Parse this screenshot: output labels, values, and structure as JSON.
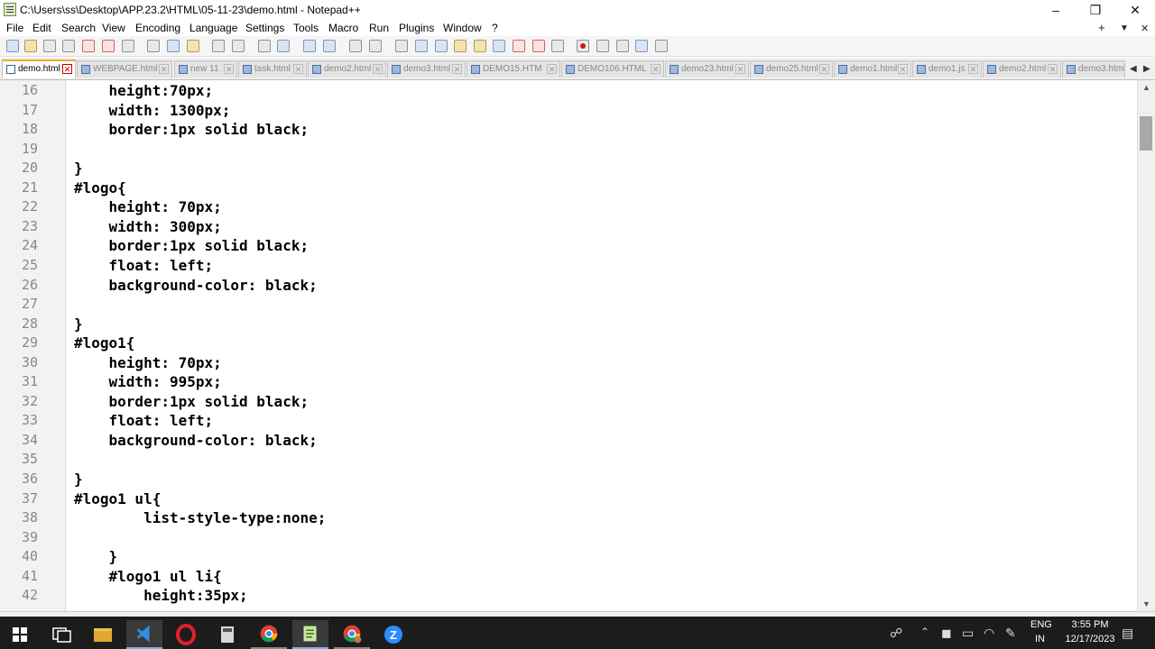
{
  "window": {
    "title": "C:\\Users\\ss\\Desktop\\APP.23.2\\HTML\\05-11-23\\demo.html - Notepad++",
    "minimize_glyph": "–",
    "restore_glyph": "❐",
    "close_glyph": "✕"
  },
  "menu": {
    "items": [
      "File",
      "Edit",
      "Search",
      "View",
      "Encoding",
      "Language",
      "Settings",
      "Tools",
      "Macro",
      "Run",
      "Plugins",
      "Window",
      "?"
    ],
    "right_plus": "+",
    "right_dropdown": "▼",
    "right_close": "✕"
  },
  "toolbar": {
    "icons": [
      "new-file-icon",
      "open-file-icon",
      "save-icon",
      "save-all-icon",
      "close-icon",
      "close-all-icon",
      "print-icon",
      "cut-icon",
      "copy-icon",
      "paste-icon",
      "undo-icon",
      "redo-icon",
      "find-icon",
      "replace-icon",
      "zoom-in-icon",
      "zoom-out-icon",
      "sync-vertical-icon",
      "sync-horizontal-icon",
      "word-wrap-icon",
      "show-all-chars-icon",
      "indent-guide-icon",
      "language-icon",
      "doc-map-icon",
      "function-list-icon",
      "folder-workspace-icon",
      "monitoring-icon",
      "record-macro-icon",
      "stop-record-icon",
      "play-macro-icon",
      "run-macro-multiple-icon",
      "save-macro-icon"
    ]
  },
  "tabs": [
    {
      "label": "demo.html",
      "active": true
    },
    {
      "label": "WEBPAGE.html",
      "active": false
    },
    {
      "label": "new 11",
      "active": false
    },
    {
      "label": "task.html",
      "active": false
    },
    {
      "label": "demo2.html",
      "active": false
    },
    {
      "label": "demo3.html",
      "active": false
    },
    {
      "label": "DEMO15.HTM",
      "active": false
    },
    {
      "label": "DEMO106.HTML",
      "active": false
    },
    {
      "label": "demo23.html",
      "active": false
    },
    {
      "label": "demo25.html",
      "active": false
    },
    {
      "label": "demo1.html",
      "active": false
    },
    {
      "label": "demo1.js",
      "active": false
    },
    {
      "label": "demo2.html",
      "active": false
    },
    {
      "label": "demo3.html",
      "active": false
    }
  ],
  "tab_scroll": {
    "left": "◀",
    "right": "▶"
  },
  "editor": {
    "lines": [
      {
        "num": "16",
        "text": "    height:70px;"
      },
      {
        "num": "17",
        "text": "    width: 1300px;"
      },
      {
        "num": "18",
        "text": "    border:1px solid black;"
      },
      {
        "num": "19",
        "text": ""
      },
      {
        "num": "20",
        "text": "}"
      },
      {
        "num": "21",
        "text": "#logo{"
      },
      {
        "num": "22",
        "text": "    height: 70px;"
      },
      {
        "num": "23",
        "text": "    width: 300px;"
      },
      {
        "num": "24",
        "text": "    border:1px solid black;"
      },
      {
        "num": "25",
        "text": "    float: left;"
      },
      {
        "num": "26",
        "text": "    background-color: black;"
      },
      {
        "num": "27",
        "text": ""
      },
      {
        "num": "28",
        "text": "}"
      },
      {
        "num": "29",
        "text": "#logo1{"
      },
      {
        "num": "30",
        "text": "    height: 70px;"
      },
      {
        "num": "31",
        "text": "    width: 995px;"
      },
      {
        "num": "32",
        "text": "    border:1px solid black;"
      },
      {
        "num": "33",
        "text": "    float: left;"
      },
      {
        "num": "34",
        "text": "    background-color: black;"
      },
      {
        "num": "35",
        "text": ""
      },
      {
        "num": "36",
        "text": "}"
      },
      {
        "num": "37",
        "text": "#logo1 ul{"
      },
      {
        "num": "38",
        "text": "        list-style-type:none;"
      },
      {
        "num": "39",
        "text": ""
      },
      {
        "num": "40",
        "text": "    }"
      },
      {
        "num": "41",
        "text": "    #logo1 ul li{"
      },
      {
        "num": "42",
        "text": "        height:35px;"
      }
    ]
  },
  "scrollbar": {
    "up": "▲",
    "down": "▼"
  },
  "taskbar": {
    "apps": [
      "start-icon",
      "task-view-icon",
      "file-explorer-icon",
      "vscode-icon",
      "opera-icon",
      "calculator-icon",
      "chrome-icon",
      "notepad-plus-plus-icon",
      "chrome-profile-icon",
      "zoom-icon"
    ],
    "lang_line1": "ENG",
    "lang_line2": "IN",
    "time": "3:55 PM",
    "date": "12/17/2023"
  },
  "colors": {
    "active_tab_accent": "#f5a623",
    "taskbar": "#1c1c1c",
    "gutter": "#f2f2f2"
  }
}
